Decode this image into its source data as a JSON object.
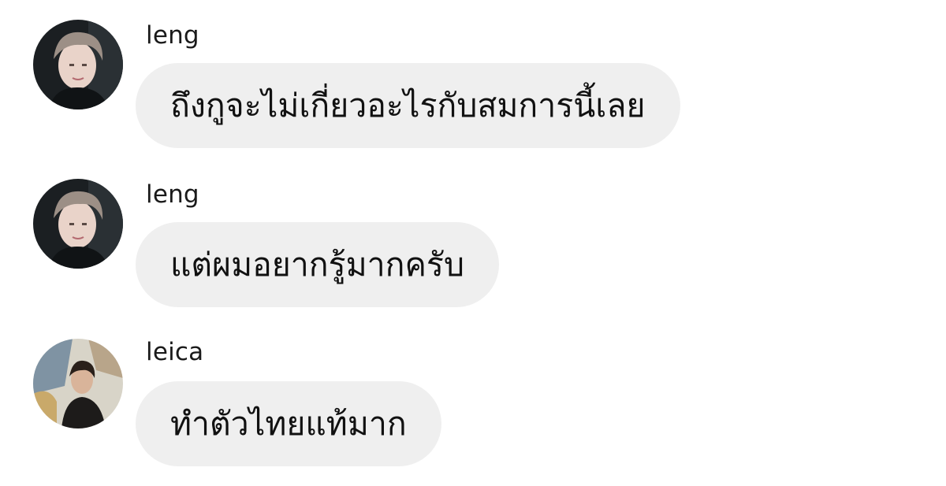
{
  "messages": [
    {
      "username": "leng",
      "text": "ถึงกูจะไม่เกี่ยวอะไรกับสมการนี้เลย",
      "avatar": "avatar-leng"
    },
    {
      "username": "leng",
      "text": "แต่ผมอยากรู้มากครับ",
      "avatar": "avatar-leng"
    },
    {
      "username": "leica",
      "text": "ทำตัวไทยแท้มาก",
      "avatar": "avatar-leica"
    }
  ],
  "colors": {
    "bubble_bg": "#efefef",
    "text": "#111111",
    "background": "#ffffff"
  }
}
